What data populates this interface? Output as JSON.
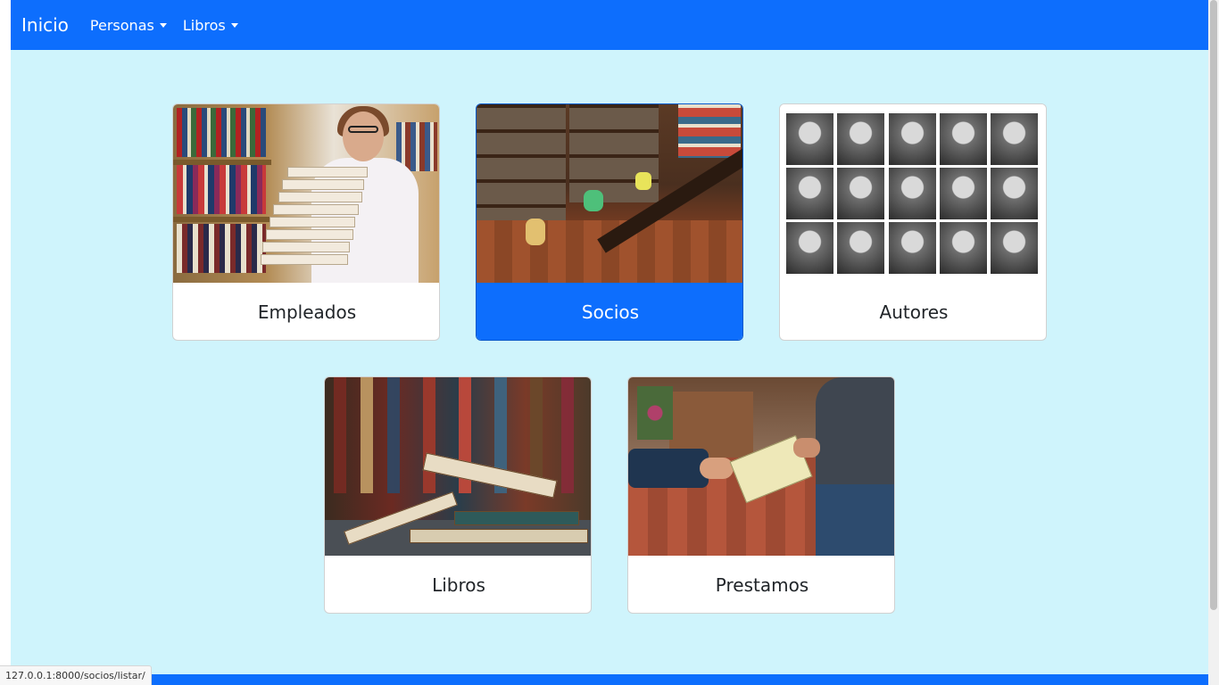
{
  "navbar": {
    "brand": "Inicio",
    "menus": [
      {
        "label": "Personas"
      },
      {
        "label": "Libros"
      }
    ],
    "color": "#0d6efd"
  },
  "cards": [
    {
      "label": "Empleados",
      "active": false
    },
    {
      "label": "Socios",
      "active": true
    },
    {
      "label": "Autores",
      "active": false
    },
    {
      "label": "Libros",
      "active": false
    },
    {
      "label": "Prestamos",
      "active": false
    }
  ],
  "status_bar": {
    "url": "127.0.0.1:8000/socios/listar/"
  },
  "colors": {
    "background": "#cff4fc",
    "accent": "#0d6efd",
    "card_text": "#212529"
  }
}
